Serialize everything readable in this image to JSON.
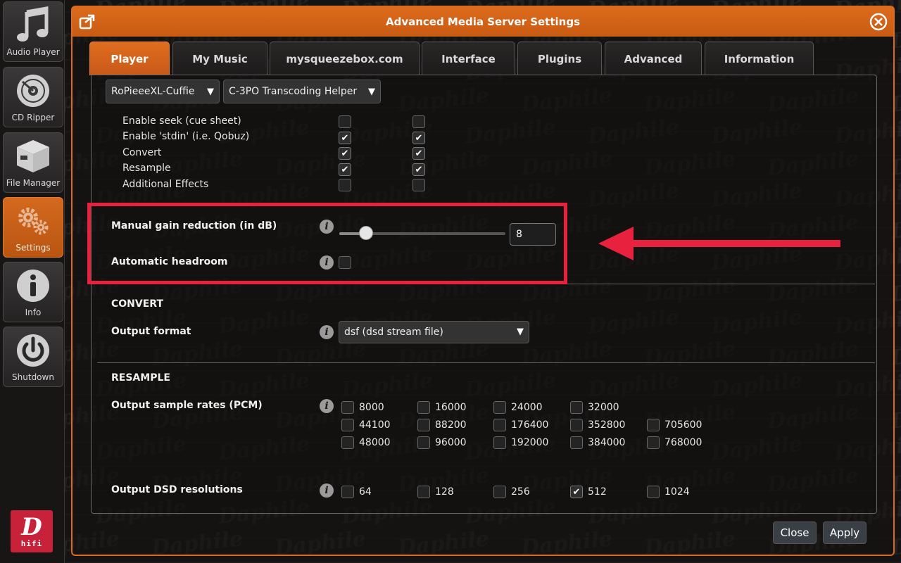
{
  "sidebar": {
    "items": [
      {
        "label": "Audio Player",
        "icon": "music-note-icon"
      },
      {
        "label": "CD Ripper",
        "icon": "disc-icon"
      },
      {
        "label": "File Manager",
        "icon": "box-icon"
      },
      {
        "label": "Settings",
        "icon": "gears-icon"
      },
      {
        "label": "Info",
        "icon": "info-icon"
      },
      {
        "label": "Shutdown",
        "icon": "power-icon"
      }
    ],
    "logo_text": "D",
    "logo_sub": "hifi"
  },
  "dialog": {
    "title": "Advanced Media Server Settings",
    "tabs": [
      "Player",
      "My Music",
      "mysqueezebox.com",
      "Interface",
      "Plugins",
      "Advanced",
      "Information"
    ],
    "active_tab": "Player"
  },
  "player": {
    "player_select": "RoPieeeXL-Cuffie",
    "plugin_select": "C-3PO Transcoding Helper",
    "options": [
      {
        "label": "Enable seek (cue sheet)",
        "col1": false,
        "col2": false
      },
      {
        "label": "Enable 'stdin' (i.e. Qobuz)",
        "col1": true,
        "col2": true
      },
      {
        "label": "Convert",
        "col1": true,
        "col2": true
      },
      {
        "label": "Resample",
        "col1": true,
        "col2": true
      },
      {
        "label": "Additional Effects",
        "col1": false,
        "col2": false
      }
    ],
    "check_glyph": "✔"
  },
  "gain": {
    "label": "Manual gain reduction (in dB)",
    "value": "8",
    "slider_fraction": 0.16
  },
  "headroom": {
    "label": "Automatic headroom",
    "checked": false
  },
  "convert": {
    "section": "CONVERT",
    "output_format_label": "Output format",
    "output_format_value": "dsf (dsd stream file)"
  },
  "resample": {
    "section": "RESAMPLE",
    "pcm_label": "Output sample rates (PCM)",
    "pcm_rates": [
      [
        "8000",
        "16000",
        "24000",
        "32000"
      ],
      [
        "44100",
        "88200",
        "176400",
        "352800",
        "705600"
      ],
      [
        "48000",
        "96000",
        "192000",
        "384000",
        "768000"
      ]
    ],
    "dsd_label": "Output DSD resolutions",
    "dsd_rates": [
      "64",
      "128",
      "256",
      "512",
      "1024"
    ],
    "dsd_checked": "512"
  },
  "footer": {
    "close_label": "Close",
    "apply_label": "Apply"
  },
  "colors": {
    "accent": "#d96a1e",
    "highlight": "#e8223e",
    "logo": "#c8223a"
  }
}
